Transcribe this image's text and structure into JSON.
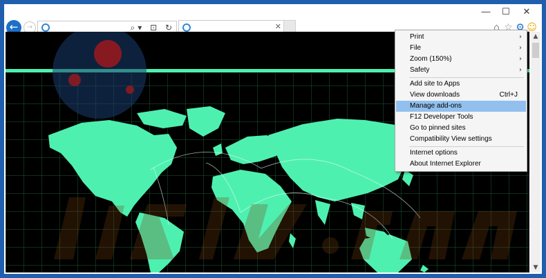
{
  "window": {
    "minimize_glyph": "—",
    "maximize_glyph": "☐",
    "close_glyph": "✕"
  },
  "toolbar": {
    "back_glyph": "←",
    "forward_glyph": "→",
    "address_buttons": "⌕▾ ⊡ ↻",
    "tab_close_glyph": "✕",
    "home_glyph": "⌂",
    "favorites_glyph": "☆",
    "tools_glyph": "⚙",
    "smiley_glyph": "☺"
  },
  "colors": {
    "ie_blue": "#1d6fc7",
    "map_land": "#4ef0b0",
    "grid_line": "#1b5a35",
    "watermark": "#5a3010",
    "menu_highlight": "#92c0ee"
  },
  "menu": {
    "items": [
      {
        "label": "Print",
        "submenu": true
      },
      {
        "label": "File",
        "submenu": true
      },
      {
        "label": "Zoom (150%)",
        "submenu": true
      },
      {
        "label": "Safety",
        "submenu": true
      },
      {
        "label": "Add site to Apps"
      },
      {
        "label": "View downloads",
        "shortcut": "Ctrl+J"
      },
      {
        "label": "Manage add-ons",
        "highlighted": true
      },
      {
        "label": "F12 Developer Tools"
      },
      {
        "label": "Go to pinned sites"
      },
      {
        "label": "Compatibility View settings"
      },
      {
        "label": "Internet options"
      },
      {
        "label": "About Internet Explorer"
      }
    ],
    "submenu_arrow": "›"
  },
  "scrollbar": {
    "up_glyph": "▲",
    "down_glyph": "▼"
  },
  "icons": [
    "back-arrow-icon",
    "forward-arrow-icon",
    "ie-logo-icon",
    "search-icon",
    "compatibility-icon",
    "refresh-icon",
    "home-icon",
    "favorites-star-icon",
    "gear-icon",
    "smiley-feedback-icon"
  ]
}
